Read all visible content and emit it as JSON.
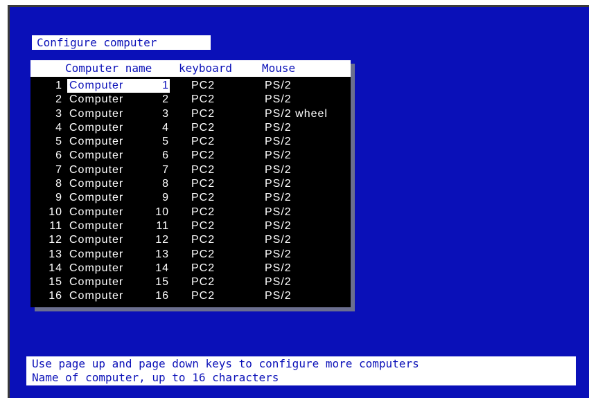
{
  "screen_title": "Configure computer",
  "columns": {
    "name": "Computer name",
    "keyboard": "keyboard",
    "mouse": "Mouse"
  },
  "rows": [
    {
      "num": "1",
      "name": "Computer",
      "id": "1",
      "keyboard": "PC2",
      "mouse": "PS/2",
      "selected": true
    },
    {
      "num": "2",
      "name": "Computer",
      "id": "2",
      "keyboard": "PC2",
      "mouse": "PS/2"
    },
    {
      "num": "3",
      "name": "Computer",
      "id": "3",
      "keyboard": "PC2",
      "mouse": "PS/2 wheel"
    },
    {
      "num": "4",
      "name": "Computer",
      "id": "4",
      "keyboard": "PC2",
      "mouse": "PS/2"
    },
    {
      "num": "5",
      "name": "Computer",
      "id": "5",
      "keyboard": "PC2",
      "mouse": "PS/2"
    },
    {
      "num": "6",
      "name": "Computer",
      "id": "6",
      "keyboard": "PC2",
      "mouse": "PS/2"
    },
    {
      "num": "7",
      "name": "Computer",
      "id": "7",
      "keyboard": "PC2",
      "mouse": "PS/2"
    },
    {
      "num": "8",
      "name": "Computer",
      "id": "8",
      "keyboard": "PC2",
      "mouse": "PS/2"
    },
    {
      "num": "9",
      "name": "Computer",
      "id": "9",
      "keyboard": "PC2",
      "mouse": "PS/2"
    },
    {
      "num": "10",
      "name": "Computer",
      "id": "10",
      "keyboard": "PC2",
      "mouse": "PS/2"
    },
    {
      "num": "11",
      "name": "Computer",
      "id": "11",
      "keyboard": "PC2",
      "mouse": "PS/2"
    },
    {
      "num": "12",
      "name": "Computer",
      "id": "12",
      "keyboard": "PC2",
      "mouse": "PS/2"
    },
    {
      "num": "13",
      "name": "Computer",
      "id": "13",
      "keyboard": "PC2",
      "mouse": "PS/2"
    },
    {
      "num": "14",
      "name": "Computer",
      "id": "14",
      "keyboard": "PC2",
      "mouse": "PS/2"
    },
    {
      "num": "15",
      "name": "Computer",
      "id": "15",
      "keyboard": "PC2",
      "mouse": "PS/2"
    },
    {
      "num": "16",
      "name": "Computer",
      "id": "16",
      "keyboard": "PC2",
      "mouse": "PS/2"
    }
  ],
  "help": {
    "line1": "Use page up and page down keys to configure more computers",
    "line2": "Name of computer, up to 16 characters"
  },
  "colors": {
    "background_blue": "#0a10b8",
    "table_background": "#000000",
    "text_white": "#ffffff"
  }
}
